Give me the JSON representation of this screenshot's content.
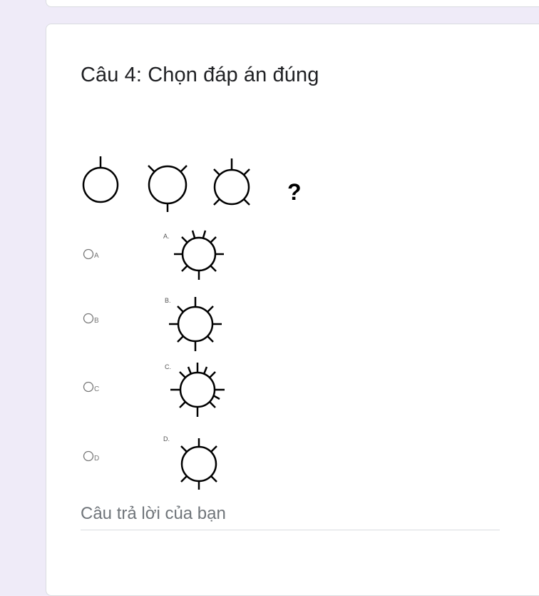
{
  "question": {
    "title": "Câu 4: Chọn đáp án đúng",
    "sequence_symbol": "?",
    "options": [
      {
        "radio_label": "A",
        "caption": "A."
      },
      {
        "radio_label": "B",
        "caption": "B."
      },
      {
        "radio_label": "C",
        "caption": "C."
      },
      {
        "radio_label": "D",
        "caption": "D."
      }
    ],
    "answer_placeholder": "Câu trả lời của bạn"
  }
}
